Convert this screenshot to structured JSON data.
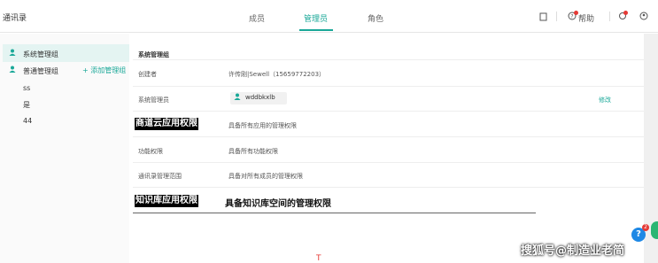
{
  "app": {
    "title": "通讯录"
  },
  "tabs": [
    {
      "label": "成员"
    },
    {
      "label": "管理员"
    },
    {
      "label": "角色"
    }
  ],
  "header": {
    "help_label": "帮助"
  },
  "sidebar": {
    "items": [
      {
        "label": "系统管理组"
      },
      {
        "label": "普通管理组"
      },
      {
        "label": "ss"
      },
      {
        "label": "是"
      },
      {
        "label": "44"
      }
    ],
    "add_label": "+ 添加管理组"
  },
  "main": {
    "section_title": "系统管理组",
    "creator_label": "创建者",
    "creator_value": "许传刚|Sewell（15659772203）",
    "admin_label": "系统管理员",
    "admin_name": "wddbkxlb",
    "modify_label": "修改",
    "permissions": [
      {
        "name": "商道云应用权限",
        "desc": "具备所有应用的管理权限"
      },
      {
        "name": "功能权限",
        "desc": "具备所有功能权限"
      },
      {
        "name": "通讯录管理范围",
        "desc": "具备对所有成员的管理权限"
      },
      {
        "name": "知识库应用权限",
        "desc": "具备知识库空间的管理权限"
      }
    ]
  },
  "watermark": "搜狐号@制造业老简",
  "help_badge": "2"
}
